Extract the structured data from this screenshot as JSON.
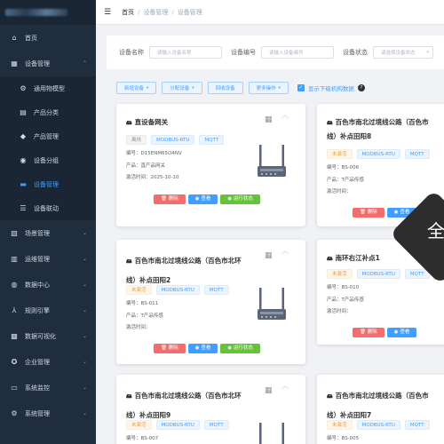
{
  "sidebar": {
    "items": [
      {
        "icon": "home-icon",
        "glyph": "⌂",
        "label": "首页"
      },
      {
        "icon": "device-mgmt-icon",
        "glyph": "▦",
        "label": "设备管理",
        "expanded": true
      },
      {
        "icon": "general-model-icon",
        "glyph": "⚙",
        "label": "通用物模型",
        "sub": true
      },
      {
        "icon": "product-category-icon",
        "glyph": "▤",
        "label": "产品分类",
        "sub": true
      },
      {
        "icon": "product-mgmt-icon",
        "glyph": "◆",
        "label": "产品管理",
        "sub": true
      },
      {
        "icon": "device-group-icon",
        "glyph": "◉",
        "label": "设备分组",
        "sub": true
      },
      {
        "icon": "device-icon",
        "glyph": "▬",
        "label": "设备管理",
        "sub": true,
        "active": true
      },
      {
        "icon": "device-linkage-icon",
        "glyph": "☰",
        "label": "设备联动",
        "sub": true
      },
      {
        "icon": "scene-icon",
        "glyph": "▧",
        "label": "场景管理"
      },
      {
        "icon": "ops-icon",
        "glyph": "▥",
        "label": "运维管理"
      },
      {
        "icon": "data-center-icon",
        "glyph": "◍",
        "label": "数据中心"
      },
      {
        "icon": "rule-engine-icon",
        "glyph": "⅄",
        "label": "规则引擎"
      },
      {
        "icon": "data-viz-icon",
        "glyph": "▩",
        "label": "数据可视化"
      },
      {
        "icon": "enterprise-icon",
        "glyph": "✪",
        "label": "企业管理"
      },
      {
        "icon": "monitor-icon",
        "glyph": "▭",
        "label": "系统监控"
      },
      {
        "icon": "system-icon",
        "glyph": "⚙",
        "label": "系统管理"
      }
    ]
  },
  "breadcrumb": [
    "首页",
    "设备管理",
    "设备管理"
  ],
  "search": {
    "name_label": "设备名称",
    "name_placeholder": "请输入设备名称",
    "code_label": "设备编号",
    "code_placeholder": "请输入设备编号",
    "status_label": "设备状态",
    "status_placeholder": "请选择设备状态"
  },
  "toolbar": {
    "buttons": [
      "新增设备",
      "分配设备",
      "回收设备",
      "更多操作"
    ],
    "checkbox_label": "显示下级机构数据"
  },
  "cards": [
    {
      "title": "直设备网关",
      "tags": [
        {
          "text": "离线",
          "style": "gray"
        },
        {
          "text": "MODBUS-RTU",
          "style": "blue"
        },
        {
          "text": "MQTT",
          "style": "blue"
        }
      ],
      "info": [
        [
          "编号：",
          "D15ENM65O4NV"
        ],
        [
          "产品：",
          "直产品网关"
        ],
        [
          "激活时间：",
          "2025-10-10"
        ]
      ],
      "actions": [
        "删除",
        "查看",
        "运行状态"
      ]
    },
    {
      "title_l1": "百色市南北过境线公路（百色市",
      "title_l2": "线）补点田阳8",
      "tags": [
        {
          "text": "未激活",
          "style": "yellow"
        },
        {
          "text": "MODBUS-RTU",
          "style": "blue"
        },
        {
          "text": "MQTT",
          "style": "blue"
        }
      ],
      "info": [
        [
          "编号：",
          "BS-006"
        ],
        [
          "产品：",
          "T产品传感"
        ],
        [
          "激活时间：",
          ""
        ]
      ],
      "actions": [
        "删除",
        "查看"
      ]
    },
    {
      "title_l1": "百色市南北过境线公路（百色市北环",
      "title_l2": "线）补点田阳2",
      "tags": [
        {
          "text": "未激活",
          "style": "yellow"
        },
        {
          "text": "MODBUS-RTU",
          "style": "blue"
        },
        {
          "text": "MQTT",
          "style": "blue"
        }
      ],
      "info": [
        [
          "编号：",
          "BS-011"
        ],
        [
          "产品：",
          "T产品传感"
        ],
        [
          "激活时间：",
          ""
        ]
      ],
      "actions": [
        "删除",
        "查看",
        "运行状态"
      ]
    },
    {
      "title": "南环右江补点1",
      "tags": [
        {
          "text": "未激活",
          "style": "yellow"
        },
        {
          "text": "MODBUS-RTU",
          "style": "blue"
        },
        {
          "text": "MQTT",
          "style": "blue"
        }
      ],
      "info": [
        [
          "编号：",
          "BS-010"
        ],
        [
          "产品：",
          "T产品传感"
        ],
        [
          "激活时间：",
          ""
        ]
      ],
      "actions": [
        "删除",
        "查看"
      ]
    },
    {
      "title_l1": "百色市南北过境线公路（百色市北环",
      "title_l2": "线）补点田阳9",
      "tags": [
        {
          "text": "未激活",
          "style": "yellow"
        },
        {
          "text": "MODBUS-RTU",
          "style": "blue"
        },
        {
          "text": "MQTT",
          "style": "blue"
        }
      ],
      "info": [
        [
          "编号：",
          "BS-007"
        ]
      ]
    },
    {
      "title_l1": "百色市南北过境线公路（百色市",
      "title_l2": "线）补点田阳7",
      "tags": [
        {
          "text": "未激活",
          "style": "yellow"
        },
        {
          "text": "MODBUS-RTU",
          "style": "blue"
        },
        {
          "text": "MQTT",
          "style": "blue"
        }
      ],
      "info": [
        [
          "编号：",
          "BS-005"
        ]
      ]
    }
  ],
  "overlay_char": "全"
}
